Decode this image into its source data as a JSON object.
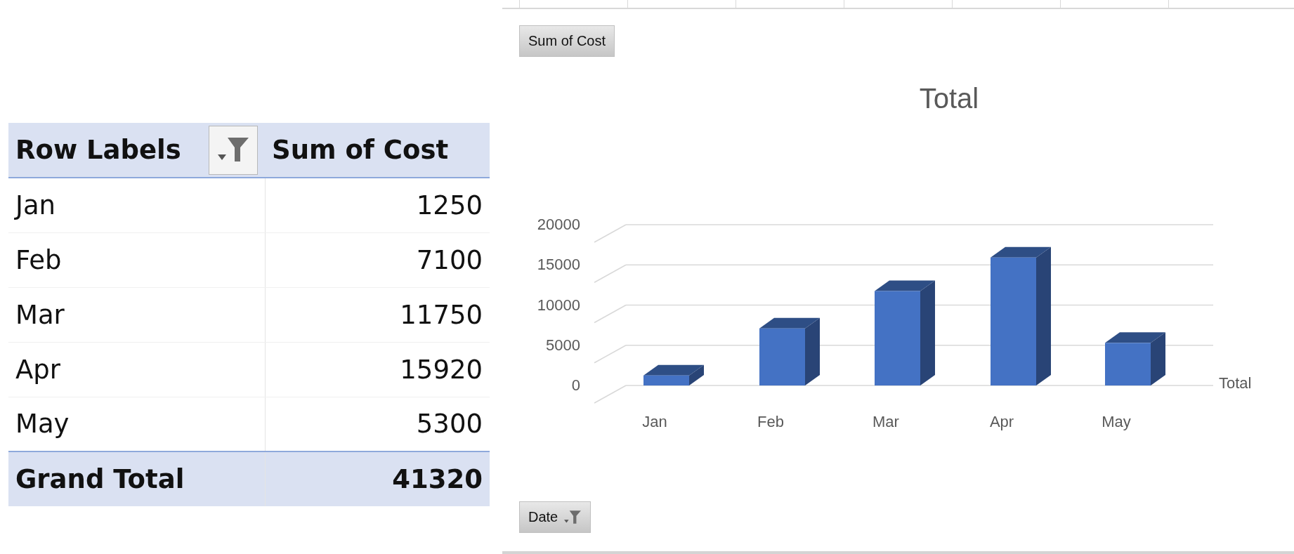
{
  "pivot_table": {
    "columns": [
      {
        "label": "Row Labels",
        "filter": true
      },
      {
        "label": "Sum of Cost",
        "filter": false
      }
    ],
    "rows": [
      {
        "label": "Jan",
        "value": "1250"
      },
      {
        "label": "Feb",
        "value": "7100"
      },
      {
        "label": "Mar",
        "value": "11750"
      },
      {
        "label": "Apr",
        "value": "15920"
      },
      {
        "label": "May",
        "value": "5300"
      }
    ],
    "grand_total": {
      "label": "Grand Total",
      "value": "41320"
    }
  },
  "chart": {
    "value_button": {
      "label": "Sum of Cost"
    },
    "series_axis_label": "Total",
    "axis_button": {
      "label": "Date",
      "filter": true
    },
    "chart_data": {
      "type": "bar",
      "title": "Total",
      "categories": [
        "Jan",
        "Feb",
        "Mar",
        "Apr",
        "May"
      ],
      "values": [
        1250,
        7100,
        11750,
        15920,
        5300
      ],
      "ylim": [
        0,
        20000
      ],
      "yticks": [
        0,
        5000,
        10000,
        15000,
        20000
      ]
    }
  }
}
